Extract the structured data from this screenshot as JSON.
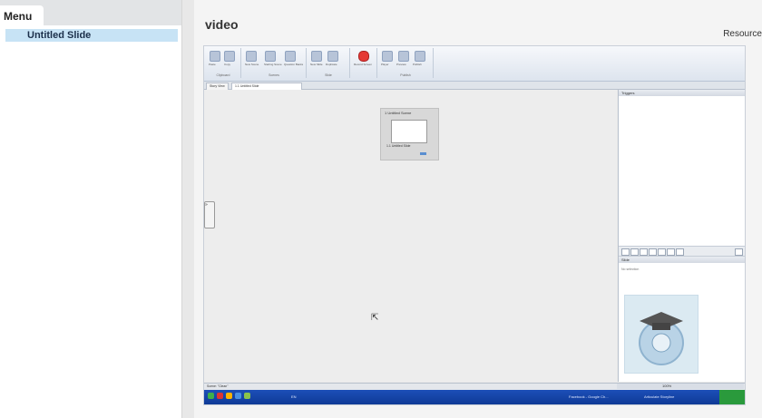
{
  "sidebar": {
    "header": "Menu",
    "items": [
      {
        "label": "Untitled Slide"
      }
    ]
  },
  "main": {
    "title": "video",
    "resources_label": "Resource"
  },
  "app": {
    "ribbon": {
      "groups": [
        {
          "label": "Clipboard",
          "buttons": [
            "Paste",
            "Copy"
          ]
        },
        {
          "label": "Scenes",
          "buttons": [
            "New Scene",
            "Starting Scene",
            "Question Banks"
          ]
        },
        {
          "label": "Slide",
          "buttons": [
            "New Slide",
            "Duplicate"
          ]
        },
        {
          "label": "",
          "buttons": [
            "Record Screen"
          ]
        },
        {
          "label": "Publish",
          "buttons": [
            "Player",
            "Preview",
            "Publish"
          ]
        }
      ]
    },
    "tabs": [
      {
        "label": "Story View"
      },
      {
        "label": "1.1 Untitled Slide"
      }
    ],
    "scene": {
      "title": "1 Untitled Scene",
      "slide_caption": "1.1 Untitled Slide"
    },
    "panels": {
      "triggers": "Triggers",
      "slide": "Slide",
      "no_selection": "No selection"
    },
    "status": {
      "text": "Scene: \"Clean\"",
      "zoom": "100%"
    },
    "taskbar": {
      "lang": "EN",
      "items": [
        "Facebook - Google Ch...",
        "Articulate Storyline"
      ]
    }
  },
  "colors": {
    "selected_item_bg": "#c7e3f5",
    "taskbar": "#1c4fb8"
  }
}
